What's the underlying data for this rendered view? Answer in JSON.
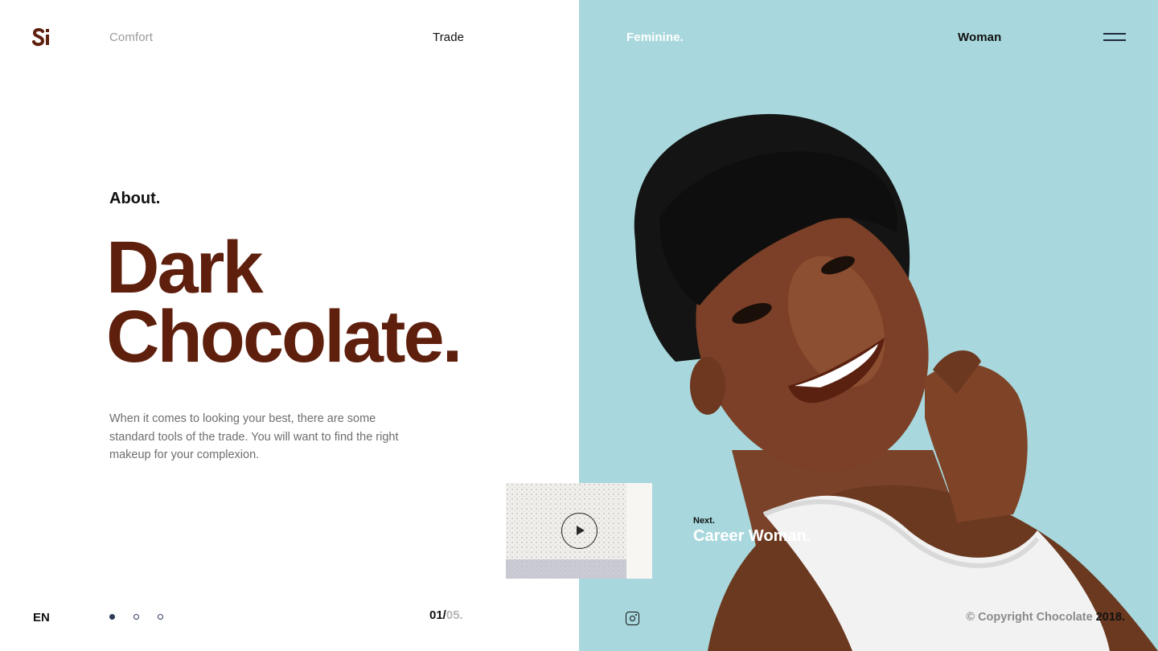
{
  "brand": {
    "logo_icon": "brand-monogram-logo",
    "color": "#5e1f0d"
  },
  "nav": {
    "left": [
      {
        "label": "Comfort",
        "state": "inactive"
      },
      {
        "label": "Trade",
        "state": "active"
      }
    ],
    "right": [
      {
        "label": "Feminine.",
        "state": "active"
      },
      {
        "label": "Woman",
        "state": "default"
      }
    ],
    "menu_icon": "hamburger-menu-icon"
  },
  "hero": {
    "eyebrow": "About.",
    "title_line1": "Dark",
    "title_line2": "Chocolate.",
    "description": "When it comes to looking your best, there are some standard tools of the trade. You will want to find the right makeup for your complexion.",
    "title_color": "#5e1f0d"
  },
  "video": {
    "play_icon": "play-icon"
  },
  "next": {
    "label": "Next.",
    "title": "Career Woman."
  },
  "footer": {
    "language": "EN",
    "slides": [
      true,
      false,
      false
    ],
    "page_current": "01/",
    "page_total": "05.",
    "social_icon": "instagram-icon",
    "copyright_text": "© Copyright Chocolate ",
    "copyright_year": "2018."
  },
  "colors": {
    "accent_bg": "#a8d8dd",
    "brown": "#5e1f0d",
    "navy": "#2d3a55"
  }
}
